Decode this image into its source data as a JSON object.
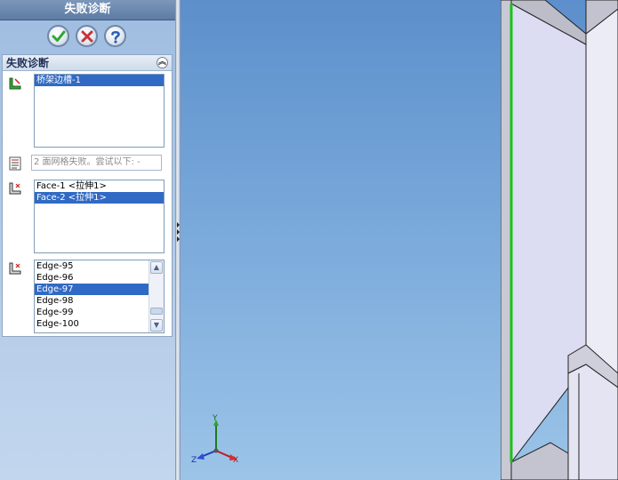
{
  "panel": {
    "title": "失败诊断",
    "section_title": "失败诊断",
    "feature_list": [
      "桥架边槽-1"
    ],
    "message": "2 面网格失败。尝试以下: -",
    "faces_list": [
      "Face-1 <拉伸1>",
      "Face-2 <拉伸1>"
    ],
    "edges_list": [
      "Edge-95",
      "Edge-96",
      "Edge-97",
      "Edge-98",
      "Edge-99",
      "Edge-100"
    ],
    "icons": {
      "ok": "checkmark-icon",
      "cancel": "x-icon",
      "help": "question-icon",
      "collapse": "double-chevron-up-icon",
      "feature": "feature-select-icon",
      "message": "list-message-icon",
      "faces": "face-select-icon",
      "edges": "edge-select-icon"
    }
  },
  "viewport": {
    "triad_labels": {
      "x": "X",
      "y": "Y",
      "z": "Z"
    },
    "colors": {
      "ok_green": "#2fa62f",
      "cancel_red": "#c8323a",
      "help_blue": "#2b5fb5",
      "selection": "#316ac5",
      "highlight_edge": "#19c319",
      "model_face": "#dcdcf2"
    }
  }
}
